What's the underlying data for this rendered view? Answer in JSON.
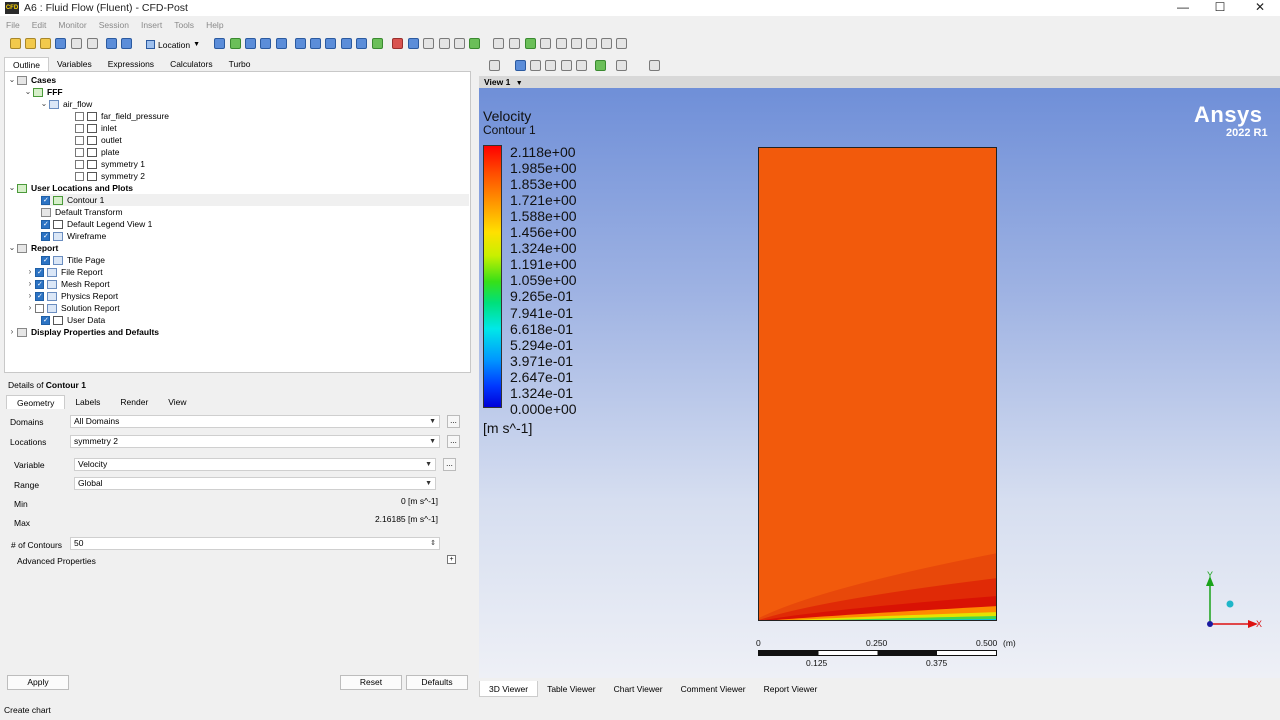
{
  "window": {
    "title": "A6 : Fluid Flow (Fluent) - CFD-Post",
    "app_icon": "CFD",
    "minimize": "—",
    "maximize": "☐",
    "close": "✕"
  },
  "menu": [
    "File",
    "Edit",
    "Monitor",
    "Session",
    "Insert",
    "Tools",
    "Help"
  ],
  "toolbar": {
    "location_label": "Location"
  },
  "outline_tabs": [
    "Outline",
    "Variables",
    "Expressions",
    "Calculators",
    "Turbo"
  ],
  "tree": {
    "cases": "Cases",
    "fff": "FFF",
    "air_flow": "air_flow",
    "boundaries": [
      "far_field_pressure",
      "inlet",
      "outlet",
      "plate",
      "symmetry 1",
      "symmetry 2"
    ],
    "user_locations": "User Locations and Plots",
    "contour": "Contour 1",
    "default_transform": "Default Transform",
    "default_legend": "Default Legend View 1",
    "wireframe": "Wireframe",
    "report": "Report",
    "report_items": [
      "Title Page",
      "File Report",
      "Mesh Report",
      "Physics Report",
      "Solution Report",
      "User Data"
    ],
    "display_props": "Display Properties and Defaults"
  },
  "details": {
    "title_prefix": "Details of ",
    "title_object": "Contour 1",
    "tabs": [
      "Geometry",
      "Labels",
      "Render",
      "View"
    ],
    "domains_label": "Domains",
    "domains_value": "All Domains",
    "locations_label": "Locations",
    "locations_value": "symmetry 2",
    "variable_label": "Variable",
    "variable_value": "Velocity",
    "range_label": "Range",
    "range_value": "Global",
    "min_label": "Min",
    "min_value": "0 [m s^-1]",
    "max_label": "Max",
    "max_value": "2.16185 [m s^-1]",
    "contours_label": "# of Contours",
    "contours_value": "50",
    "advanced_label": "Advanced Properties",
    "dots": "...",
    "apply": "Apply",
    "reset": "Reset",
    "defaults": "Defaults"
  },
  "status": "Create chart",
  "viewer": {
    "view_label": "View 1",
    "legend_title": "Velocity",
    "legend_subtitle": "Contour 1",
    "legend_values": [
      "2.118e+00",
      "1.985e+00",
      "1.853e+00",
      "1.721e+00",
      "1.588e+00",
      "1.456e+00",
      "1.324e+00",
      "1.191e+00",
      "1.059e+00",
      "9.265e-01",
      "7.941e-01",
      "6.618e-01",
      "5.294e-01",
      "3.971e-01",
      "2.647e-01",
      "1.324e-01",
      "0.000e+00"
    ],
    "legend_unit": "[m s^-1]",
    "brand": "Ansys",
    "version": "2022 R1",
    "scale_top": [
      "0",
      "0.250",
      "0.500",
      "(m)"
    ],
    "scale_bottom": [
      "0.125",
      "0.375"
    ],
    "axis_y": "Y",
    "axis_x": "X",
    "tabs": [
      "3D Viewer",
      "Table Viewer",
      "Chart Viewer",
      "Comment Viewer",
      "Report Viewer"
    ]
  }
}
